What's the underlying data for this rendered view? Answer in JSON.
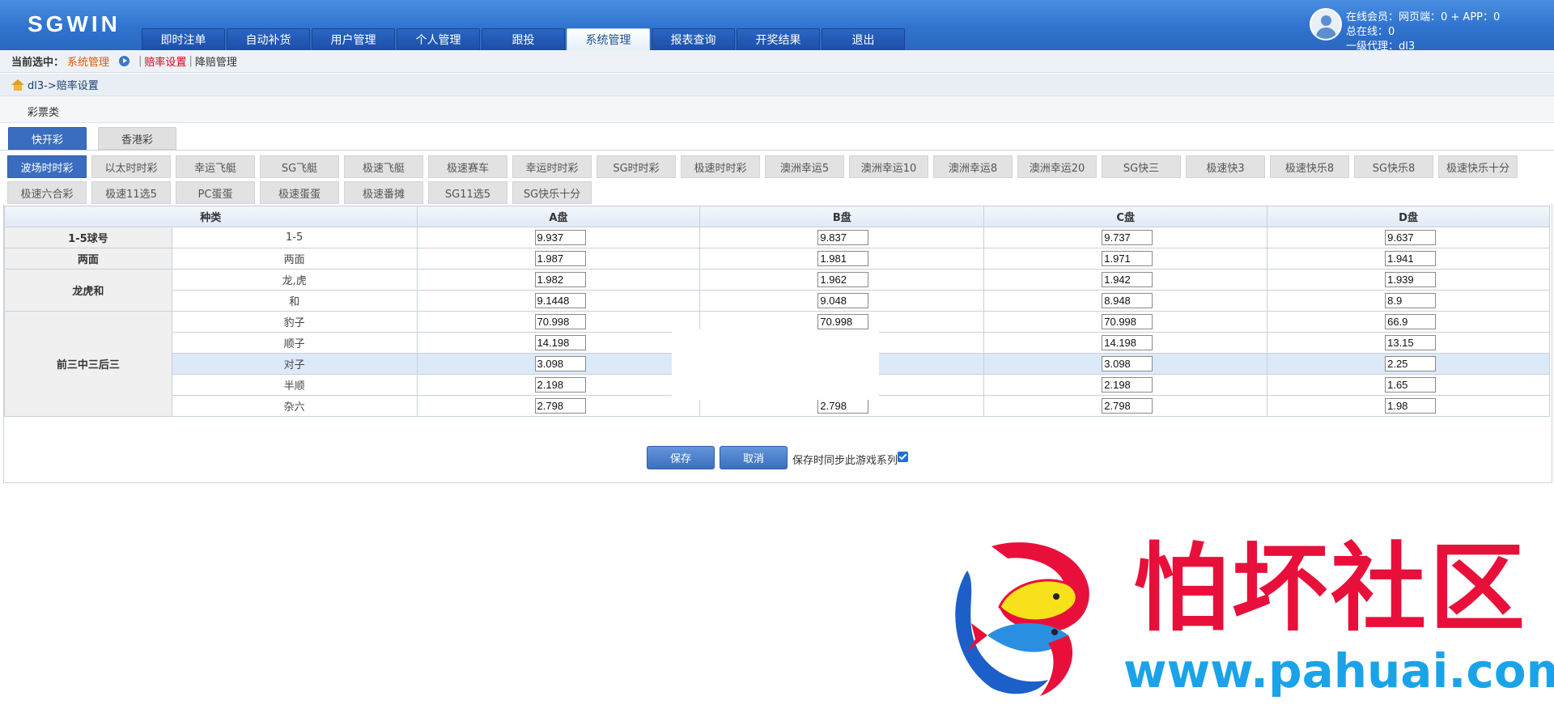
{
  "header": {
    "logo": "SGWIN",
    "tabs": [
      "即时注单",
      "自动补货",
      "用户管理",
      "个人管理",
      "跟投",
      "系统管理",
      "报表查询",
      "开奖结果",
      "退出"
    ],
    "active_tab": "系统管理",
    "user": {
      "online": "在线会员：网页端：0 + APP：0",
      "total": "总在线：0",
      "level": "一级代理：dl3"
    }
  },
  "subbar": {
    "label": "当前选中：",
    "current": "系统管理",
    "sep1": "|",
    "link1": "赔率设置",
    "sep2": "|",
    "link2": "降赔管理"
  },
  "breadcrumb": "dl3->赔率设置",
  "category_label": "彩票类",
  "group_tabs": [
    "快开彩",
    "香港彩"
  ],
  "lottery_tabs_row1": [
    "波场时时彩",
    "以太时时彩",
    "幸运飞艇",
    "SG飞艇",
    "极速飞艇",
    "极速赛车",
    "幸运时时彩",
    "SG时时彩",
    "极速时时彩",
    "澳洲幸运5",
    "澳洲幸运10",
    "澳洲幸运8",
    "澳洲幸运20",
    "SG快三",
    "极速快3",
    "极速快乐8",
    "SG快乐8",
    "极速快乐十分"
  ],
  "lottery_tabs_row2": [
    "极速六合彩",
    "极速11选5",
    "PC蛋蛋",
    "极速蛋蛋",
    "极速番摊",
    "SG11选5",
    "SG快乐十分"
  ],
  "table": {
    "headers": {
      "kind": "种类",
      "a": "A盘",
      "b": "B盘",
      "c": "C盘",
      "d": "D盘"
    },
    "groups": {
      "g1": "1-5球号",
      "g2": "两面",
      "g3": "龙虎和",
      "g4": "前三中三后三"
    },
    "rows": [
      {
        "name": "1-5",
        "a": "9.937",
        "b": "9.837",
        "c": "9.737",
        "d": "9.637"
      },
      {
        "name": "两面",
        "a": "1.987",
        "b": "1.981",
        "c": "1.971",
        "d": "1.941"
      },
      {
        "name": "龙,虎",
        "a": "1.982",
        "b": "1.962",
        "c": "1.942",
        "d": "1.939"
      },
      {
        "name": "和",
        "a": "9.1448",
        "b": "9.048",
        "c": "8.948",
        "d": "8.9"
      },
      {
        "name": "豹子",
        "a": "70.998",
        "b": "70.998",
        "c": "70.998",
        "d": "66.9"
      },
      {
        "name": "顺子",
        "a": "14.198",
        "b": "",
        "c": "14.198",
        "d": "13.15"
      },
      {
        "name": "对子",
        "a": "3.098",
        "b": "",
        "c": "3.098",
        "d": "2.25"
      },
      {
        "name": "半顺",
        "a": "2.198",
        "b": "",
        "c": "2.198",
        "d": "1.65"
      },
      {
        "name": "杂六",
        "a": "2.798",
        "b": "2.798",
        "c": "2.798",
        "d": "1.98"
      }
    ]
  },
  "actions": {
    "save": "保存",
    "cancel": "取消",
    "sync_label": "保存时同步此游戏系列"
  },
  "watermark": {
    "title": "怕坏社区",
    "url": "www.pahuai.com"
  }
}
